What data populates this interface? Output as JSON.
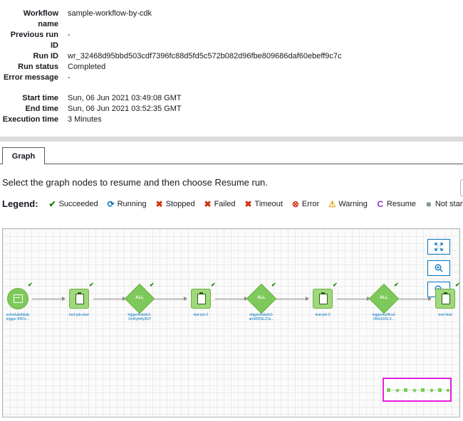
{
  "details": {
    "rows": [
      {
        "label": "Workflow name",
        "value": "sample-workflow-by-cdk"
      },
      {
        "label": "Previous run ID",
        "value": "-"
      },
      {
        "label": "Run ID",
        "value": "wr_32468d95bbd503cdf7396fc88d5fd5c572b082d96fbe809686daf60ebeff9c7c"
      },
      {
        "label": "Run status",
        "value": "Completed"
      },
      {
        "label": "Error message",
        "value": "-"
      }
    ],
    "label_lines": {
      "workflow_name_1": "Workflow",
      "workflow_name_2": "name",
      "previous_run_1": "Previous run",
      "previous_run_2": "ID"
    },
    "times": [
      {
        "label": "Start time",
        "value": "Sun, 06 Jun 2021 03:49:08 GMT"
      },
      {
        "label": "End time",
        "value": "Sun, 06 Jun 2021 03:52:35 GMT"
      },
      {
        "label": "Execution time",
        "value": "3 Minutes"
      }
    ]
  },
  "tabs": {
    "graph": "Graph"
  },
  "instruction": "Select the graph nodes to resume and then choose Resume run.",
  "legend": {
    "title": "Legend:",
    "items": [
      {
        "label": "Succeeded",
        "icon": "check-icon",
        "glyph": "✔",
        "color": "#1d8102"
      },
      {
        "label": "Running",
        "icon": "refresh-icon",
        "glyph": "⟳",
        "color": "#0073bb"
      },
      {
        "label": "Stopped",
        "icon": "x-icon",
        "glyph": "✖",
        "color": "#d13212"
      },
      {
        "label": "Failed",
        "icon": "x-icon",
        "glyph": "✖",
        "color": "#d13212"
      },
      {
        "label": "Timeout",
        "icon": "x-icon",
        "glyph": "✖",
        "color": "#d13212"
      },
      {
        "label": "Error",
        "icon": "error-circle-icon",
        "glyph": "⊗",
        "color": "#d13212"
      },
      {
        "label": "Warning",
        "icon": "warning-icon",
        "glyph": "⚠",
        "color": "#e8a317"
      },
      {
        "label": "Resume",
        "icon": "resume-icon",
        "glyph": "C",
        "color": "#8a35c9"
      },
      {
        "label": "Not started",
        "icon": "square-icon",
        "glyph": "■",
        "color": "#879596"
      }
    ]
  },
  "graph": {
    "trigger_text": "ALL",
    "nodes": [
      {
        "type": "schedule",
        "label_1": "scheduleddaily",
        "label_2": "trigger-KN7o..."
      },
      {
        "type": "job",
        "label_1": "test-job-start",
        "label_2": ""
      },
      {
        "type": "trigger",
        "label_1": "triggertestjob2-",
        "label_2": "2mRyfn8y3NT"
      },
      {
        "type": "job",
        "label_1": "test-job-2",
        "label_2": ""
      },
      {
        "type": "trigger",
        "label_1": "triggertestjob3-",
        "label_2": "amR05SLZ1k..."
      },
      {
        "type": "job",
        "label_1": "test-job-3",
        "label_2": ""
      },
      {
        "type": "trigger",
        "label_1": "triggertestfinal-",
        "label_2": "0WzS1RLX..."
      },
      {
        "type": "job",
        "label_1": "test-final",
        "label_2": ""
      }
    ],
    "status_icon": "check-icon",
    "status_color": "#1d8102",
    "node_color": "#7dc95b",
    "minimap_border_color": "#e91ee0"
  },
  "zoom_controls": [
    "fit-icon",
    "zoom-in-icon",
    "zoom-out-icon"
  ]
}
